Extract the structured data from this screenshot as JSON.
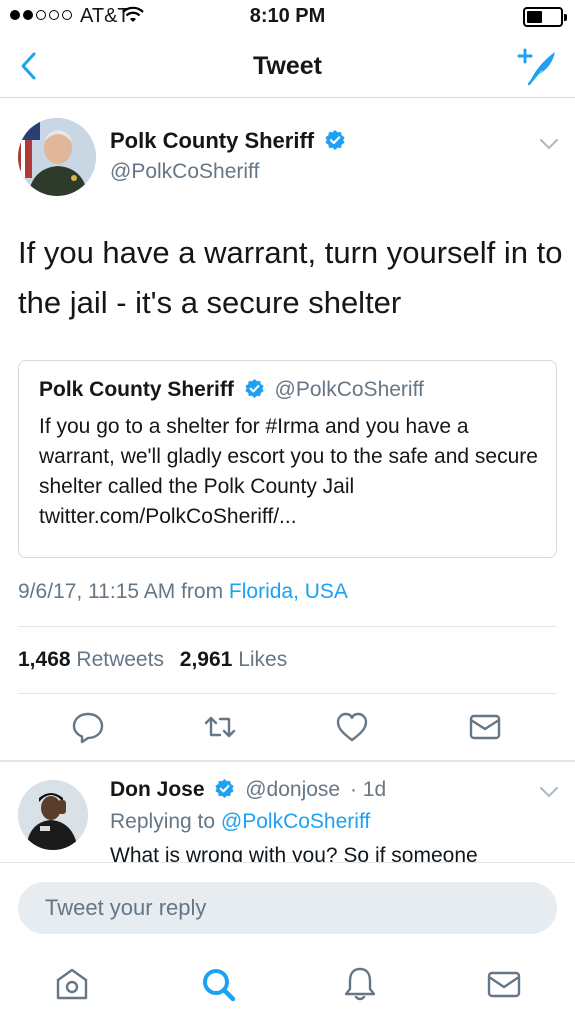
{
  "status_bar": {
    "carrier": "AT&T",
    "time": "8:10 PM"
  },
  "nav": {
    "title": "Tweet"
  },
  "tweet": {
    "author_name": "Polk County Sheriff",
    "author_handle": "@PolkCoSheriff",
    "text": "If you have a warrant, turn yourself in to the jail - it's a secure shelter",
    "quoted": {
      "author_name": "Polk County Sheriff",
      "author_handle": "@PolkCoSheriff",
      "text": "If you go to a shelter for #Irma and you have a warrant, we'll gladly escort you to the safe and secure shelter called the Polk County Jail twitter.com/PolkCoSheriff/..."
    },
    "timestamp": "9/6/17, 11:15 AM from ",
    "location": "Florida, USA",
    "retweets_count": "1,468",
    "retweets_label": "Retweets",
    "likes_count": "2,961",
    "likes_label": "Likes"
  },
  "reply": {
    "author_name": "Don Jose",
    "author_handle": "@donjose",
    "age": "· 1d",
    "replying_prefix": "Replying to ",
    "replying_to": "@PolkCoSheriff",
    "text": "What is wrong with you? So if someone"
  },
  "composer": {
    "placeholder": "Tweet your reply"
  },
  "colors": {
    "accent": "#1da1f2",
    "secondary_text": "#657786",
    "divider": "#e1e8ed"
  },
  "icons": [
    "back-chevron-icon",
    "compose-tweet-icon",
    "verified-badge-icon",
    "dropdown-chevron-icon",
    "reply-icon",
    "retweet-icon",
    "like-heart-icon",
    "direct-message-icon",
    "home-icon",
    "search-icon",
    "notifications-bell-icon",
    "messages-envelope-icon"
  ]
}
